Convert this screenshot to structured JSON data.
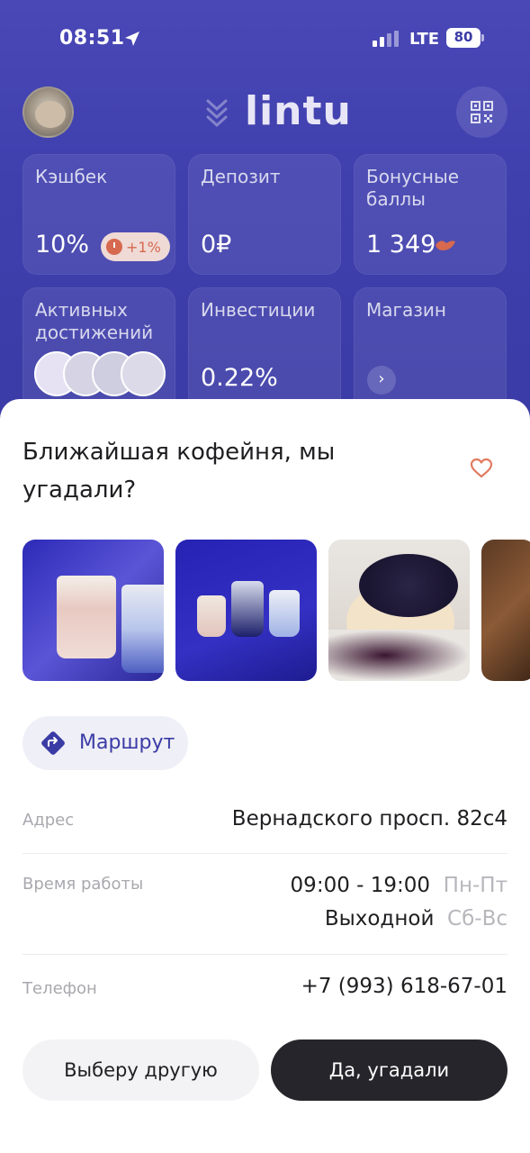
{
  "status_bar": {
    "time": "08:51",
    "network": "LTE",
    "battery": "80"
  },
  "header": {
    "logo": "lintu"
  },
  "tiles": {
    "cashback": {
      "label": "Кэшбек",
      "value": "10%",
      "extra": "+1%"
    },
    "deposit": {
      "label": "Депозит",
      "value": "0₽"
    },
    "bonus": {
      "label": "Бонусные баллы",
      "value": "1 349"
    },
    "achievements": {
      "label": "Активных достижений"
    },
    "investments": {
      "label": "Инвестиции",
      "value": "0.22%"
    },
    "shop": {
      "label": "Магазин",
      "arrow": "›"
    }
  },
  "sheet": {
    "title": "Ближайшая кофейня, мы угадали?",
    "route_label": "Маршрут",
    "address_label": "Адрес",
    "address_value": "Вернадского просп. 82с4",
    "hours_label": "Время работы",
    "hours_weekday_time": "09:00 - 19:00",
    "hours_weekday_days": "Пн-Пт",
    "hours_weekend_time": "Выходной",
    "hours_weekend_days": "Сб-Вс",
    "phone_label": "Телефон",
    "phone_value": "+7 (993) 618-67-01",
    "btn_other": "Выберу другую",
    "btn_yes": "Да, угадали"
  },
  "colors": {
    "header_bg": "#3f3fae",
    "accent": "#3b3ba6",
    "heart": "#e07a5f",
    "primary_button": "#25252b"
  }
}
